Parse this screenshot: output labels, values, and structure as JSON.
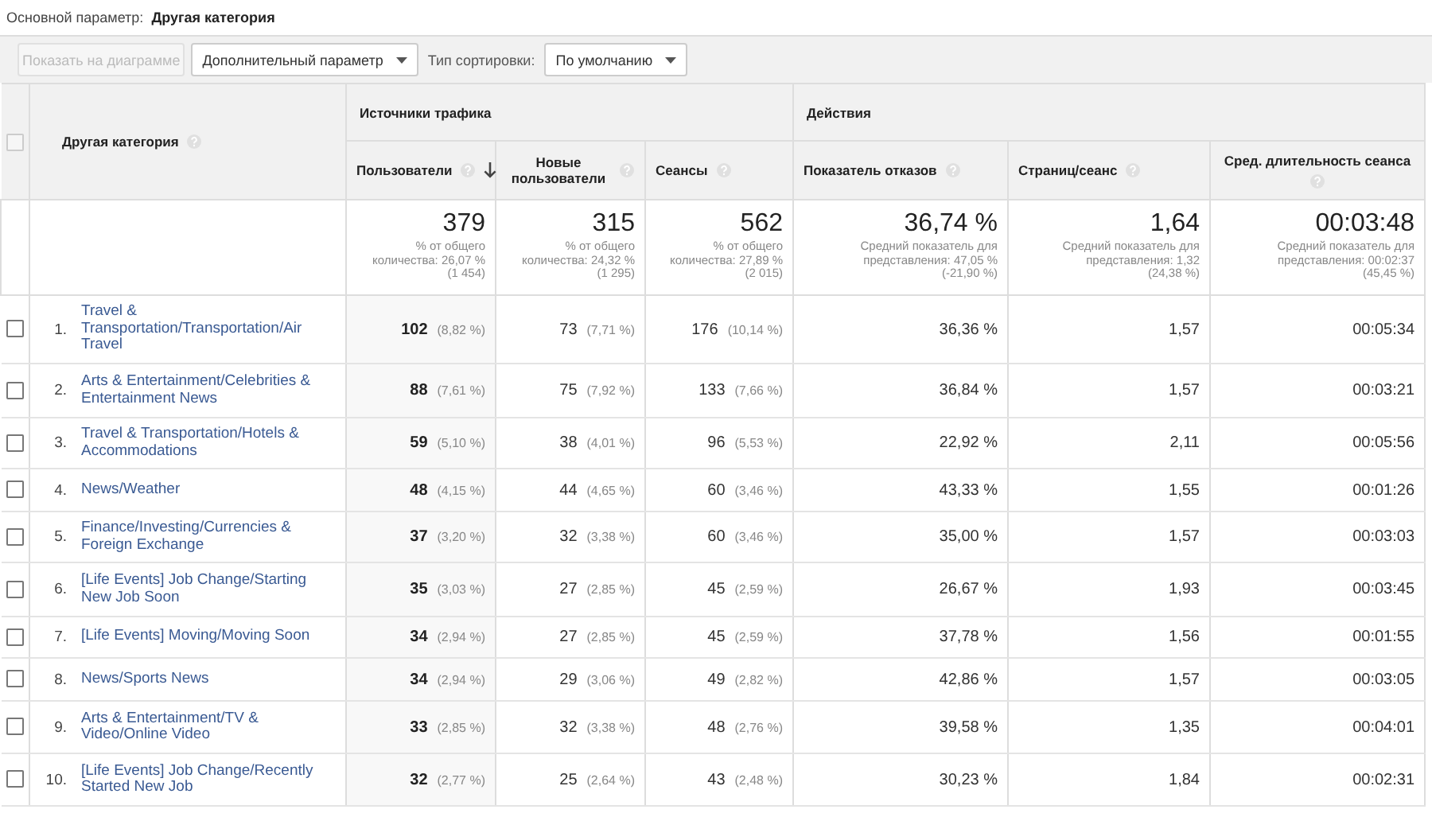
{
  "primary_dimension": {
    "label": "Основной параметр:",
    "value": "Другая категория"
  },
  "toolbar": {
    "chart_button": {
      "label": "Показать на диаграмме",
      "disabled": true
    },
    "secondary_dropdown": {
      "label": "Дополнительный параметр"
    },
    "sort_label": "Тип сортировки:",
    "sort_dropdown": {
      "value": "По умолчанию"
    }
  },
  "table": {
    "header_checkbox": {
      "checked": false
    },
    "dimension_column": "Другая категория",
    "groups": [
      {
        "label": "Источники трафика",
        "columns": [
          {
            "label": "Пользователи",
            "sorted": true
          },
          {
            "label": "Новые пользователи",
            "sorted": false
          },
          {
            "label": "Сеансы",
            "sorted": false
          }
        ]
      },
      {
        "label": "Действия",
        "columns": [
          {
            "label": "Показатель отказов",
            "sorted": false
          },
          {
            "label": "Страниц/сеанс",
            "sorted": false
          },
          {
            "label": "Сред. длительность сеанса",
            "sorted": false
          }
        ]
      }
    ],
    "totals": [
      {
        "value": "379",
        "note": "% от общего\nколичества: 26,07 %\n(1 454)"
      },
      {
        "value": "315",
        "note": "% от общего\nколичества: 24,32 %\n(1 295)"
      },
      {
        "value": "562",
        "note": "% от общего\nколичества: 27,89 %\n(2 015)"
      },
      {
        "value": "36,74 %",
        "note": "Средний показатель для\nпредставления: 47,05 %\n(-21,90 %)"
      },
      {
        "value": "1,64",
        "note": "Средний показатель для\nпредставления: 1,32\n(24,38 %)"
      },
      {
        "value": "00:03:48",
        "note": "Средний показатель для\nпредставления: 00:02:37\n(45,45 %)"
      }
    ],
    "rows": [
      {
        "index": "1.",
        "category": "Travel & Transportation/Transportation/Air Travel",
        "checked": false,
        "cells": [
          {
            "value": "102",
            "share": "(8,82 %)"
          },
          {
            "value": "73",
            "share": "(7,71 %)"
          },
          {
            "value": "176",
            "share": "(10,14 %)"
          },
          {
            "value": "36,36 %"
          },
          {
            "value": "1,57"
          },
          {
            "value": "00:05:34"
          }
        ]
      },
      {
        "index": "2.",
        "category": "Arts & Entertainment/Celebrities & Entertainment News",
        "checked": false,
        "cells": [
          {
            "value": "88",
            "share": "(7,61 %)"
          },
          {
            "value": "75",
            "share": "(7,92 %)"
          },
          {
            "value": "133",
            "share": "(7,66 %)"
          },
          {
            "value": "36,84 %"
          },
          {
            "value": "1,57"
          },
          {
            "value": "00:03:21"
          }
        ]
      },
      {
        "index": "3.",
        "category": "Travel & Transportation/Hotels & Accommodations",
        "checked": false,
        "cells": [
          {
            "value": "59",
            "share": "(5,10 %)"
          },
          {
            "value": "38",
            "share": "(4,01 %)"
          },
          {
            "value": "96",
            "share": "(5,53 %)"
          },
          {
            "value": "22,92 %"
          },
          {
            "value": "2,11"
          },
          {
            "value": "00:05:56"
          }
        ]
      },
      {
        "index": "4.",
        "category": "News/Weather",
        "checked": false,
        "cells": [
          {
            "value": "48",
            "share": "(4,15 %)"
          },
          {
            "value": "44",
            "share": "(4,65 %)"
          },
          {
            "value": "60",
            "share": "(3,46 %)"
          },
          {
            "value": "43,33 %"
          },
          {
            "value": "1,55"
          },
          {
            "value": "00:01:26"
          }
        ]
      },
      {
        "index": "5.",
        "category": "Finance/Investing/Currencies & Foreign Exchange",
        "checked": false,
        "cells": [
          {
            "value": "37",
            "share": "(3,20 %)"
          },
          {
            "value": "32",
            "share": "(3,38 %)"
          },
          {
            "value": "60",
            "share": "(3,46 %)"
          },
          {
            "value": "35,00 %"
          },
          {
            "value": "1,57"
          },
          {
            "value": "00:03:03"
          }
        ]
      },
      {
        "index": "6.",
        "category": "[Life Events] Job Change/Starting New Job Soon",
        "checked": false,
        "cells": [
          {
            "value": "35",
            "share": "(3,03 %)"
          },
          {
            "value": "27",
            "share": "(2,85 %)"
          },
          {
            "value": "45",
            "share": "(2,59 %)"
          },
          {
            "value": "26,67 %"
          },
          {
            "value": "1,93"
          },
          {
            "value": "00:03:45"
          }
        ]
      },
      {
        "index": "7.",
        "category": "[Life Events] Moving/Moving Soon",
        "checked": false,
        "cells": [
          {
            "value": "34",
            "share": "(2,94 %)"
          },
          {
            "value": "27",
            "share": "(2,85 %)"
          },
          {
            "value": "45",
            "share": "(2,59 %)"
          },
          {
            "value": "37,78 %"
          },
          {
            "value": "1,56"
          },
          {
            "value": "00:01:55"
          }
        ]
      },
      {
        "index": "8.",
        "category": "News/Sports News",
        "checked": false,
        "cells": [
          {
            "value": "34",
            "share": "(2,94 %)"
          },
          {
            "value": "29",
            "share": "(3,06 %)"
          },
          {
            "value": "49",
            "share": "(2,82 %)"
          },
          {
            "value": "42,86 %"
          },
          {
            "value": "1,57"
          },
          {
            "value": "00:03:05"
          }
        ]
      },
      {
        "index": "9.",
        "category": "Arts & Entertainment/TV & Video/Online Video",
        "checked": false,
        "cells": [
          {
            "value": "33",
            "share": "(2,85 %)"
          },
          {
            "value": "32",
            "share": "(3,38 %)"
          },
          {
            "value": "48",
            "share": "(2,76 %)"
          },
          {
            "value": "39,58 %"
          },
          {
            "value": "1,35"
          },
          {
            "value": "00:04:01"
          }
        ]
      },
      {
        "index": "10.",
        "category": "[Life Events] Job Change/Recently Started New Job",
        "checked": false,
        "cells": [
          {
            "value": "32",
            "share": "(2,77 %)"
          },
          {
            "value": "25",
            "share": "(2,64 %)"
          },
          {
            "value": "43",
            "share": "(2,48 %)"
          },
          {
            "value": "30,23 %"
          },
          {
            "value": "1,84"
          },
          {
            "value": "00:02:31"
          }
        ]
      }
    ]
  }
}
